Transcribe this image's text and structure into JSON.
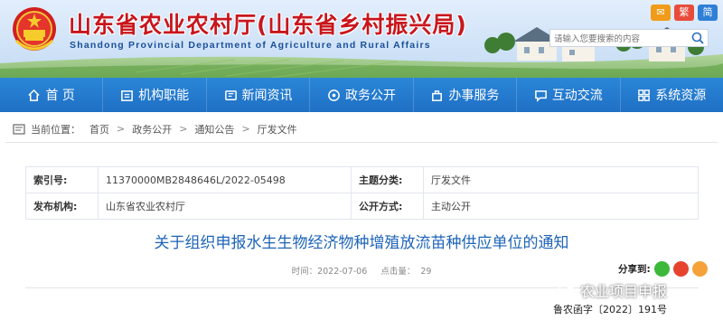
{
  "header": {
    "title": "山东省农业农村厅(山东省乡村振兴局)",
    "subtitle": "Shandong Provincial Department of Agriculture and Rural Affairs",
    "tools": {
      "mail": "✉",
      "fan": "繁",
      "jian": "简"
    },
    "search": {
      "placeholder": "请输入您要搜索的内容"
    }
  },
  "nav": {
    "items": [
      {
        "label": "首 页",
        "icon": "home-icon"
      },
      {
        "label": "机构职能",
        "icon": "org-icon"
      },
      {
        "label": "新闻资讯",
        "icon": "news-icon"
      },
      {
        "label": "政务公开",
        "icon": "gov-icon"
      },
      {
        "label": "办事服务",
        "icon": "service-icon"
      },
      {
        "label": "互动交流",
        "icon": "chat-icon"
      },
      {
        "label": "系统资源",
        "icon": "system-icon"
      }
    ]
  },
  "breadcrumb": {
    "prefix": "当前位置：",
    "items": [
      "首页",
      "政务公开",
      "通知公告",
      "厅发文件"
    ],
    "separator": ">"
  },
  "meta": {
    "index_key": "索引号:",
    "index_val": "11370000MB2848646L/2022-05498",
    "category_key": "主题分类:",
    "category_val": "厅发文件",
    "publisher_key": "发布机构:",
    "publisher_val": "山东省农业农村厅",
    "mode_key": "公开方式:",
    "mode_val": "主动公开"
  },
  "article": {
    "title": "关于组织申报水生生物经济物种增殖放流苗种供应单位的通知",
    "time_label": "时间：2022-07-06",
    "clicks_label": "点击量：",
    "clicks": "29",
    "share_label": "分享到:",
    "watermark": "农业项目申报",
    "doc_number": "鲁农函字〔2022〕191号"
  },
  "colors": {
    "brand_red": "#c8161d",
    "nav_blue": "#1f70c5",
    "title_blue": "#1e64b8"
  }
}
